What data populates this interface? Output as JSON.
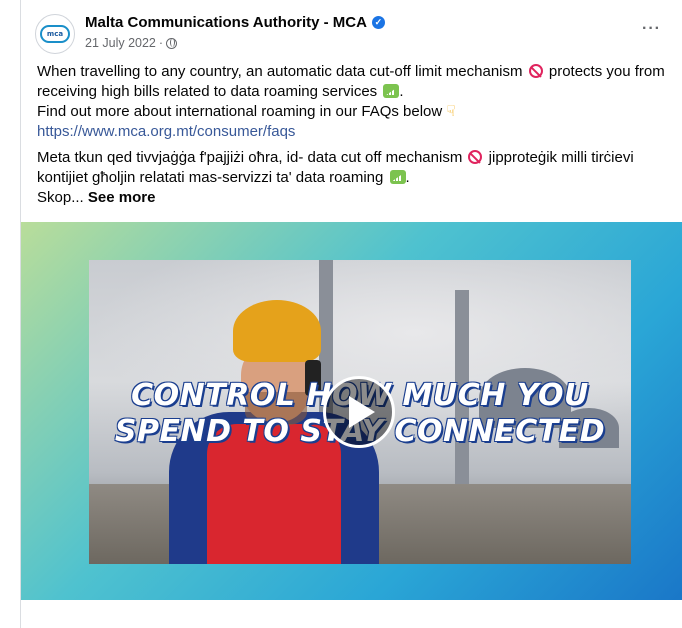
{
  "post": {
    "page_name": "Malta Communications Authority - MCA",
    "avatar_text": "mca",
    "date": "21 July 2022",
    "separator": "·",
    "more_label": "···",
    "english": {
      "line1a": "When travelling to any country, an automatic data cut-off limit mechanism",
      "line1b": "protects you from",
      "line2": "receiving high bills related to data roaming services",
      "line2_end": ".",
      "line3": "Find out more about international roaming in our FAQs below",
      "link": "https://www.mca.org.mt/consumer/faqs"
    },
    "maltese": {
      "line1a": "Meta tkun qed tivvjaġġa f'pajjiżi oħra, id- data cut off mechanism",
      "line1b": "jipproteġik milli tirċievi",
      "line2": "kontijiet għoljin relatati mas-servizzi ta' data roaming",
      "line2_end": ".",
      "line3": "Skop...",
      "see_more": "See more"
    },
    "video": {
      "headline_line1": "CONTROL HOW MUCH YOU",
      "headline_line2": "SPEND TO STAY CONNECTED"
    }
  },
  "icons": [
    "verified-icon",
    "globe-icon",
    "more-options-icon",
    "prohibited-icon",
    "signal-icon",
    "pointing-down-icon",
    "play-icon"
  ],
  "colors": {
    "link": "#385898",
    "verified": "#1b74e4",
    "muted": "#65676b"
  }
}
